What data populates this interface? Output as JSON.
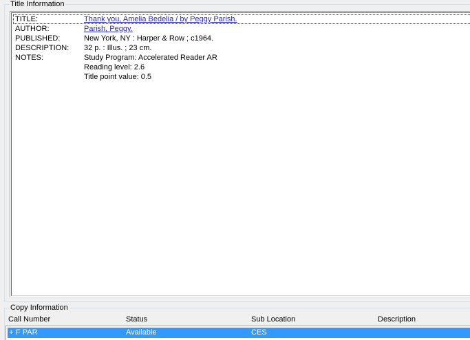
{
  "title_info": {
    "legend": "Title Information",
    "rows": [
      {
        "label": "TITLE:",
        "value": "Thank you, Amelia Bedelia / by Peggy Parish.",
        "link": true
      },
      {
        "label": "AUTHOR:",
        "value": "Parish, Peggy.",
        "link": true
      },
      {
        "label": "PUBLISHED:",
        "value": "New York, NY : Harper & Row ; c1964.",
        "link": false
      },
      {
        "label": "DESCRIPTION:",
        "value": "32 p. : Illus. ; 23 cm.",
        "link": false
      },
      {
        "label": "NOTES:",
        "value": "Study Program: Accelerated Reader AR",
        "link": false
      },
      {
        "label": "",
        "value": "Reading level: 2.6",
        "link": false
      },
      {
        "label": "",
        "value": "Title point value: 0.5",
        "link": false
      }
    ]
  },
  "copy_info": {
    "legend": "Copy Information",
    "columns": [
      "Call Number",
      "Status",
      "Sub Location",
      "Description"
    ],
    "rows": [
      {
        "expander": "+",
        "call_number": "F PAR",
        "status": "Available",
        "sub_location": "CES",
        "description": "",
        "selected": true
      }
    ]
  },
  "colors": {
    "selection": "#3399ff",
    "link": "#2b2bb0",
    "background": "#f0f0f0"
  }
}
